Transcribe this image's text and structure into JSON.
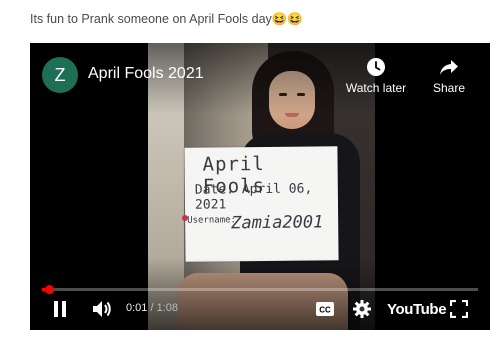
{
  "post": {
    "caption": "Its fun to Prank someone on April Fools day😆😆"
  },
  "player": {
    "channel_initial": "Z",
    "title": "April Fools 2021",
    "watch_later_label": "Watch later",
    "share_label": "Share",
    "current_time": "0:01",
    "time_separator": " / ",
    "duration": "1:08",
    "progress_fraction": 0.015,
    "brand": "YouTube",
    "cc_label": "CC",
    "accent_color": "#ff0000",
    "avatar_color": "#1d6f55"
  },
  "video_frame": {
    "sign_line1": "April Fools",
    "sign_line2": "Date: April 06, 2021",
    "sign_label": "Username:",
    "sign_username": "Zamia2001"
  },
  "icons": [
    "clock-icon",
    "share-arrow-icon",
    "pause-icon",
    "volume-icon",
    "captions-icon",
    "gear-icon",
    "fullscreen-icon"
  ]
}
